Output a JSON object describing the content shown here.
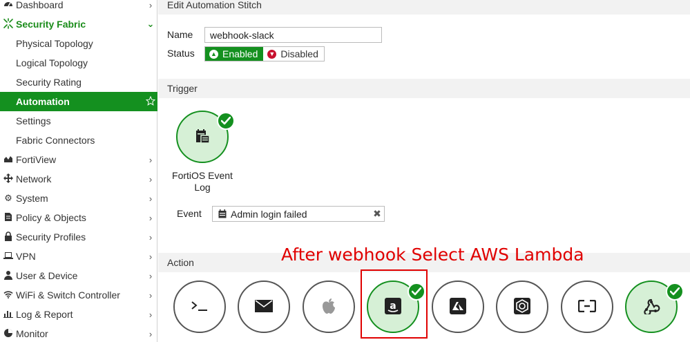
{
  "sidebar": {
    "items": [
      {
        "label": "Dashboard",
        "icon": "dashboard-icon"
      },
      {
        "label": "Security Fabric",
        "icon": "security-fabric-icon"
      },
      {
        "label": "Physical Topology"
      },
      {
        "label": "Logical Topology"
      },
      {
        "label": "Security Rating"
      },
      {
        "label": "Automation"
      },
      {
        "label": "Settings"
      },
      {
        "label": "Fabric Connectors"
      },
      {
        "label": "FortiView",
        "icon": "fortiview-icon"
      },
      {
        "label": "Network",
        "icon": "network-icon"
      },
      {
        "label": "System",
        "icon": "gear-icon"
      },
      {
        "label": "Policy & Objects",
        "icon": "document-icon"
      },
      {
        "label": "Security Profiles",
        "icon": "lock-icon"
      },
      {
        "label": "VPN",
        "icon": "laptop-icon"
      },
      {
        "label": "User & Device",
        "icon": "user-icon"
      },
      {
        "label": "WiFi & Switch Controller",
        "icon": "wifi-icon"
      },
      {
        "label": "Log & Report",
        "icon": "bar-chart-icon"
      },
      {
        "label": "Monitor",
        "icon": "monitor-icon"
      }
    ]
  },
  "main": {
    "title": "Edit Automation Stitch",
    "name_label": "Name",
    "name_value": "webhook-slack",
    "status_label": "Status",
    "status_enabled": "Enabled",
    "status_disabled": "Disabled",
    "trigger_header": "Trigger",
    "trigger_caption_line1": "FortiOS Event",
    "trigger_caption_line2": "Log",
    "event_label": "Event",
    "event_value": "Admin login failed",
    "action_header": "Action",
    "annotation": "After webhook Select AWS Lambda",
    "actions": [
      {
        "icon": "cli-script-icon",
        "selected": false
      },
      {
        "icon": "email-icon",
        "selected": false
      },
      {
        "icon": "apple-icon",
        "selected": false
      },
      {
        "icon": "aws-lambda-icon",
        "selected": true
      },
      {
        "icon": "azure-function-icon",
        "selected": false
      },
      {
        "icon": "google-cloud-function-icon",
        "selected": false
      },
      {
        "icon": "alicloud-function-icon",
        "selected": false
      },
      {
        "icon": "webhook-icon",
        "selected": true
      }
    ]
  },
  "colors": {
    "accent": "#14901f",
    "selected_fill": "#d6f0d6",
    "annotation": "#e00000",
    "section_bg": "#f2f2f2"
  }
}
